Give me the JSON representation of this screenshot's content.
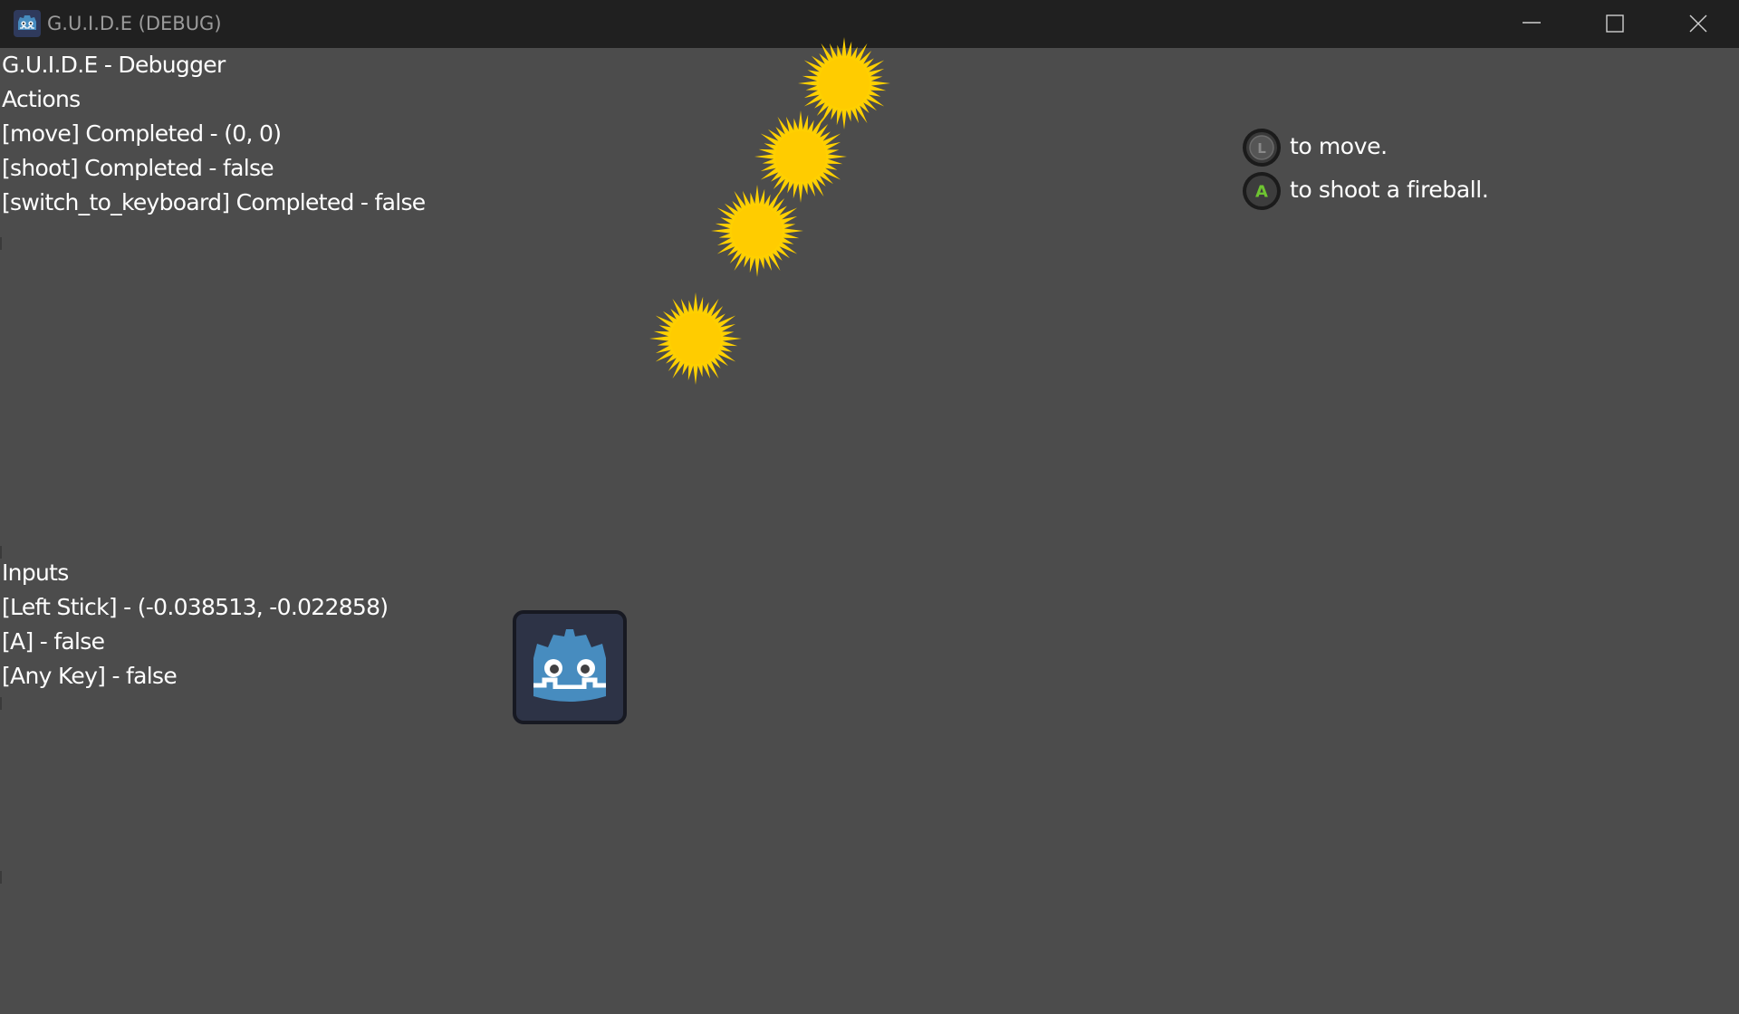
{
  "window": {
    "title": "G.U.I.D.E (DEBUG)",
    "icon": "godot-icon"
  },
  "window_controls": {
    "minimize_icon": "minimize-icon",
    "maximize_icon": "maximize-icon",
    "close_icon": "close-icon"
  },
  "debugger": {
    "heading": "G.U.I.D.E - Debugger",
    "actions_heading": "Actions",
    "actions": [
      "[move] Completed - (0, 0)",
      "[shoot] Completed - false",
      "[switch_to_keyboard] Completed - false"
    ],
    "inputs_heading": "Inputs",
    "inputs": [
      "[Left Stick] - (-0.038513, -0.022858)",
      "[A] - false",
      "[Any Key] - false"
    ]
  },
  "hints": [
    {
      "glyph": "L",
      "icon": "left-stick-icon",
      "text": "to move.",
      "glyph_color": "#7a7a7a"
    },
    {
      "glyph": "A",
      "icon": "a-button-icon",
      "text": "to shoot a fireball.",
      "glyph_color": "#6ec531"
    }
  ],
  "colors": {
    "background": "#4c4c4c",
    "titlebar": "#202020",
    "fireball": "#ffd000",
    "player": "#478cbf"
  },
  "game": {
    "fireball_count": 4,
    "player_icon": "godot-robot-icon"
  }
}
